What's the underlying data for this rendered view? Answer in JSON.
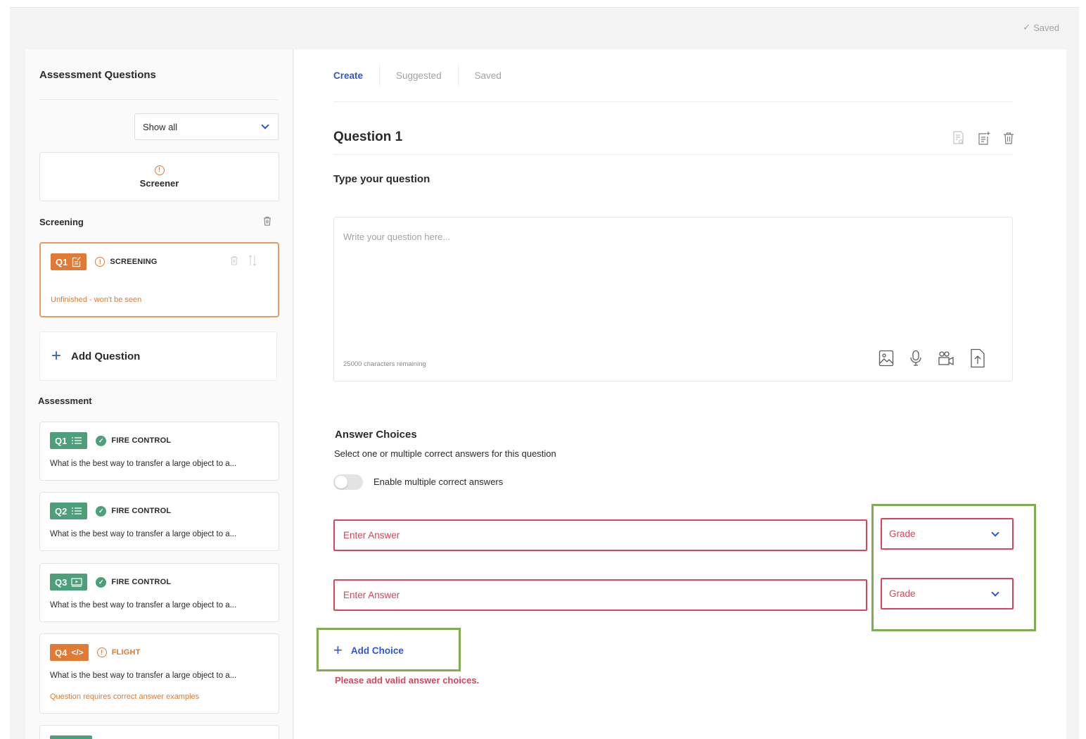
{
  "status": {
    "saved": "Saved"
  },
  "sidebar": {
    "title": "Assessment Questions",
    "filter": {
      "value": "Show all"
    },
    "screener": {
      "label": "Screener"
    },
    "screening_section": "Screening",
    "assessment_section": "Assessment",
    "add_question": "Add Question",
    "screening_card": {
      "badge": "Q1",
      "type": "SCREENING",
      "note": "Unfinished - won't be seen"
    },
    "assessment_cards": [
      {
        "badge": "Q1",
        "type": "FIRE CONTROL",
        "text": "What is the best way to transfer a large object to a..."
      },
      {
        "badge": "Q2",
        "type": "FIRE CONTROL",
        "text": "What is the best way to transfer a large object to a..."
      },
      {
        "badge": "Q3",
        "type": "FIRE CONTROL",
        "text": "What is the best way to transfer a large object to a..."
      },
      {
        "badge": "Q4",
        "type": "FLIGHT",
        "text": "What is the best way to transfer a large object to a...",
        "note": "Question requires correct answer examples"
      }
    ]
  },
  "tabs": [
    {
      "label": "Create"
    },
    {
      "label": "Suggested"
    },
    {
      "label": "Saved"
    }
  ],
  "question": {
    "title": "Question 1",
    "type_label": "Type your question",
    "placeholder": "Write your question here...",
    "chars_remaining": "25000 characters remaining"
  },
  "answers": {
    "title": "Answer Choices",
    "hint": "Select one or multiple correct answers for this question",
    "toggle_label": "Enable multiple correct answers",
    "placeholder": "Enter Answer",
    "grade_label": "Grade",
    "add_choice": "Add Choice",
    "error": "Please add valid answer choices."
  },
  "colors": {
    "accent": "#2f56d4",
    "error": "#d9455b",
    "warning": "#e07a35",
    "success": "#4d9f7c",
    "highlight": "#7fad52"
  }
}
